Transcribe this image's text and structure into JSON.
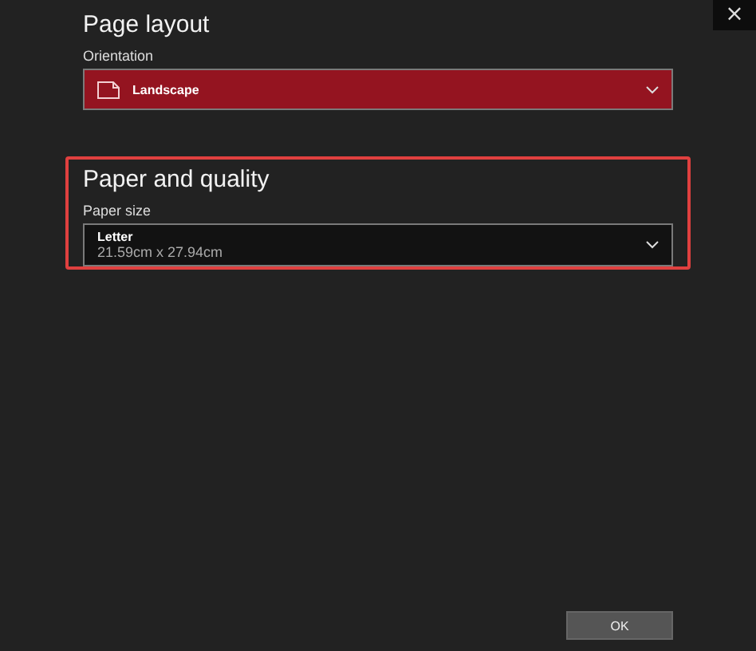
{
  "close_button": {
    "label": "×"
  },
  "sections": [
    {
      "title": "Page layout",
      "highlighted": false,
      "field": {
        "label": "Orientation",
        "kind": "orientation",
        "value": "Landscape"
      }
    },
    {
      "title": "Paper and quality",
      "highlighted": true,
      "field": {
        "label": "Paper size",
        "kind": "paper",
        "value": "Letter",
        "detail": "21.59cm x 27.94cm"
      }
    }
  ],
  "buttons": [
    "OK"
  ]
}
